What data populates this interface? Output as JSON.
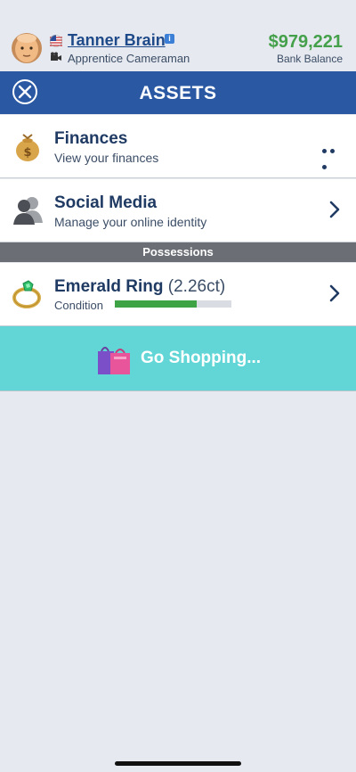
{
  "profile": {
    "name": "Tanner Brain",
    "info_badge": "i",
    "job": "Apprentice Cameraman",
    "balance": "$979,221",
    "balance_label": "Bank Balance"
  },
  "titlebar": {
    "title": "ASSETS"
  },
  "rows": [
    {
      "label": "Finances",
      "sub": "View your finances",
      "icon": "money-bag-icon",
      "action": "more-dots-icon"
    },
    {
      "label": "Social Media",
      "sub": "Manage your online identity",
      "icon": "people-silhouette-icon",
      "action": "chevron-right-icon"
    }
  ],
  "section": {
    "title": "Possessions"
  },
  "possessions": [
    {
      "name": "Emerald Ring",
      "carat": "(2.26ct)",
      "condition_label": "Condition",
      "condition_value": 0.7,
      "icon": "emerald-ring-icon"
    }
  ],
  "shop": {
    "label": "Go Shopping...",
    "icon": "shopping-bags-icon"
  },
  "colors": {
    "header_blue": "#2a58a3",
    "balance_green": "#44a04a",
    "shop_cyan": "#62d6d6",
    "condition_green": "#3ea344"
  }
}
